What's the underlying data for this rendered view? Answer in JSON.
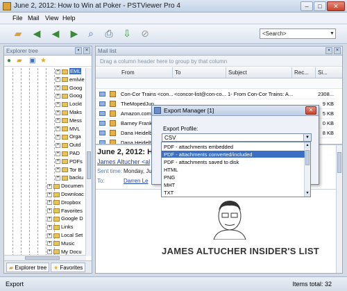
{
  "window": {
    "title": "June 2, 2012: How to Win at Poker - PSTViewer Pro 4",
    "minimize": "–",
    "maximize": "□",
    "close": "✕"
  },
  "menu": [
    "File",
    "Mail",
    "View",
    "Help"
  ],
  "toolbar": {
    "icons": [
      "open-folder-icon",
      "back-icon",
      "reply-all-icon",
      "forward-icon",
      "search-folder-icon",
      "print-icon",
      "export-icon",
      "stop-icon"
    ],
    "search_value": "<Search>"
  },
  "explorer": {
    "header": "Explorer tree",
    "tree": [
      {
        "label": "EML",
        "selected": true
      },
      {
        "label": "emlvie"
      },
      {
        "label": "Goog"
      },
      {
        "label": "Goog"
      },
      {
        "label": "Lockt"
      },
      {
        "label": "Maks"
      },
      {
        "label": "Mess"
      },
      {
        "label": "MVL"
      },
      {
        "label": "Orga"
      },
      {
        "label": "Outd"
      },
      {
        "label": "PAD"
      },
      {
        "label": "PDFs"
      },
      {
        "label": "Tor B"
      },
      {
        "label": "backu"
      },
      {
        "label": "Documen"
      },
      {
        "label": "Downloac"
      },
      {
        "label": "Dropbox"
      },
      {
        "label": "Favorites"
      },
      {
        "label": "Google D"
      },
      {
        "label": "Links"
      },
      {
        "label": "Local Set"
      },
      {
        "label": "Music"
      },
      {
        "label": "My Docu"
      }
    ],
    "tabs": [
      "Explorer tree",
      "Favorites"
    ]
  },
  "maillist": {
    "header": "Mail list",
    "group_hint": "Drag a column header here to group by that column",
    "columns": [
      "From",
      "To",
      "Subject",
      "Rec...",
      "Si..."
    ],
    "rows": [
      {
        "from": "Con-Cor Trains <con...",
        "to": "<concor-list@con-co...",
        "subject": "1- From Con-Cor Trains: A...",
        "size": "2308..."
      },
      {
        "from": "TheMopedJun",
        "to": "",
        "subject": "",
        "size": "9 KB"
      },
      {
        "from": "Amazon.com",
        "to": "",
        "subject": "",
        "size": "5 KB"
      },
      {
        "from": "Barney Frank",
        "to": "",
        "subject": "",
        "size": "0 KB"
      },
      {
        "from": "Dana Heidelb",
        "to": "",
        "subject": "",
        "size": "8 KB"
      },
      {
        "from": "Dana Heidelb",
        "to": "",
        "subject": "",
        "size": ""
      }
    ]
  },
  "preview": {
    "title": "June 2, 2012: Ho",
    "from": "James Altucher <al",
    "sent_label": "Sent time:",
    "sent_value": "Monday, Ju",
    "to_label": "To:",
    "to_value": "Darren Le",
    "banner": "JAMES ALTUCHER INSIDER'S LIST"
  },
  "dialog": {
    "title": "Export Manager [1]",
    "close": "✕",
    "profile_label": "Export Profile:",
    "profile_value": "CSV",
    "options": [
      "PDF - attachments embedded",
      "PDF - attachments converted/included",
      "PDF - attachments saved to disk",
      "HTML",
      "PNG",
      "MHT",
      "TXT"
    ],
    "selected_index": 1
  },
  "status": {
    "left": "Export",
    "right": "Items total: 32"
  }
}
